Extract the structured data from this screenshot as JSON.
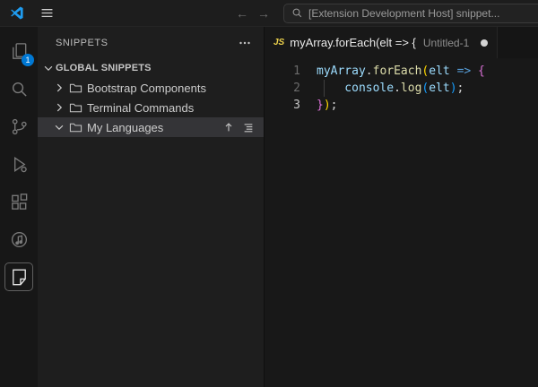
{
  "colors": {
    "accent": "#0078d4",
    "badge": "#0078d4",
    "js_badge": "#ecd14c",
    "var": "#9cdcfe",
    "fn": "#dcdcaa",
    "kw": "#569cd6",
    "plain": "#d4d4d4",
    "b1": "#ffd700",
    "b2": "#da70d6",
    "b3": "#179fff"
  },
  "icons": {
    "back_arrow": "←",
    "forward_arrow": "→",
    "names": [
      "vscode-logo",
      "menu-icon",
      "back-icon",
      "forward-icon",
      "search-icon",
      "more-actions-icon",
      "chevron-down-icon",
      "chevron-right-icon",
      "folder-icon",
      "move-up-icon",
      "collapse-list-icon",
      "files-icon",
      "source-control-icon",
      "debug-icon",
      "extensions-icon",
      "music-note-icon",
      "snippets-icon",
      "modified-dot-icon"
    ]
  },
  "title_bar": {
    "command_text": "[Extension Development Host] snippet..."
  },
  "activity_bar": {
    "explorer_badge": "1"
  },
  "sidebar": {
    "title": "SNIPPETS",
    "section": {
      "label": "GLOBAL SNIPPETS",
      "expanded": true
    },
    "items": [
      {
        "label": "Bootstrap Components",
        "expanded": false
      },
      {
        "label": "Terminal Commands",
        "expanded": false
      },
      {
        "label": "My Languages",
        "expanded": true,
        "selected": true
      }
    ]
  },
  "editor": {
    "tab": {
      "lang_badge": "JS",
      "label": "myArray.forEach(elt => {",
      "secondary": "Untitled-1",
      "modified": true
    },
    "lines": [
      {
        "number": "1",
        "tokens": [
          {
            "t": "myArray",
            "c": "var"
          },
          {
            "t": ".",
            "c": "plain"
          },
          {
            "t": "forEach",
            "c": "fn"
          },
          {
            "t": "(",
            "c": "b1"
          },
          {
            "t": "elt",
            "c": "var"
          },
          {
            "t": " ",
            "c": "plain"
          },
          {
            "t": "=>",
            "c": "kw"
          },
          {
            "t": " ",
            "c": "plain"
          },
          {
            "t": "{",
            "c": "b2"
          }
        ]
      },
      {
        "number": "2",
        "indent": 1,
        "tokens": [
          {
            "t": "console",
            "c": "var"
          },
          {
            "t": ".",
            "c": "plain"
          },
          {
            "t": "log",
            "c": "fn"
          },
          {
            "t": "(",
            "c": "b3"
          },
          {
            "t": "elt",
            "c": "var"
          },
          {
            "t": ")",
            "c": "b3"
          },
          {
            "t": ";",
            "c": "plain"
          }
        ]
      },
      {
        "number": "3",
        "active": true,
        "tokens": [
          {
            "t": "}",
            "c": "b2"
          },
          {
            "t": ")",
            "c": "b1"
          },
          {
            "t": ";",
            "c": "plain"
          }
        ]
      }
    ]
  }
}
